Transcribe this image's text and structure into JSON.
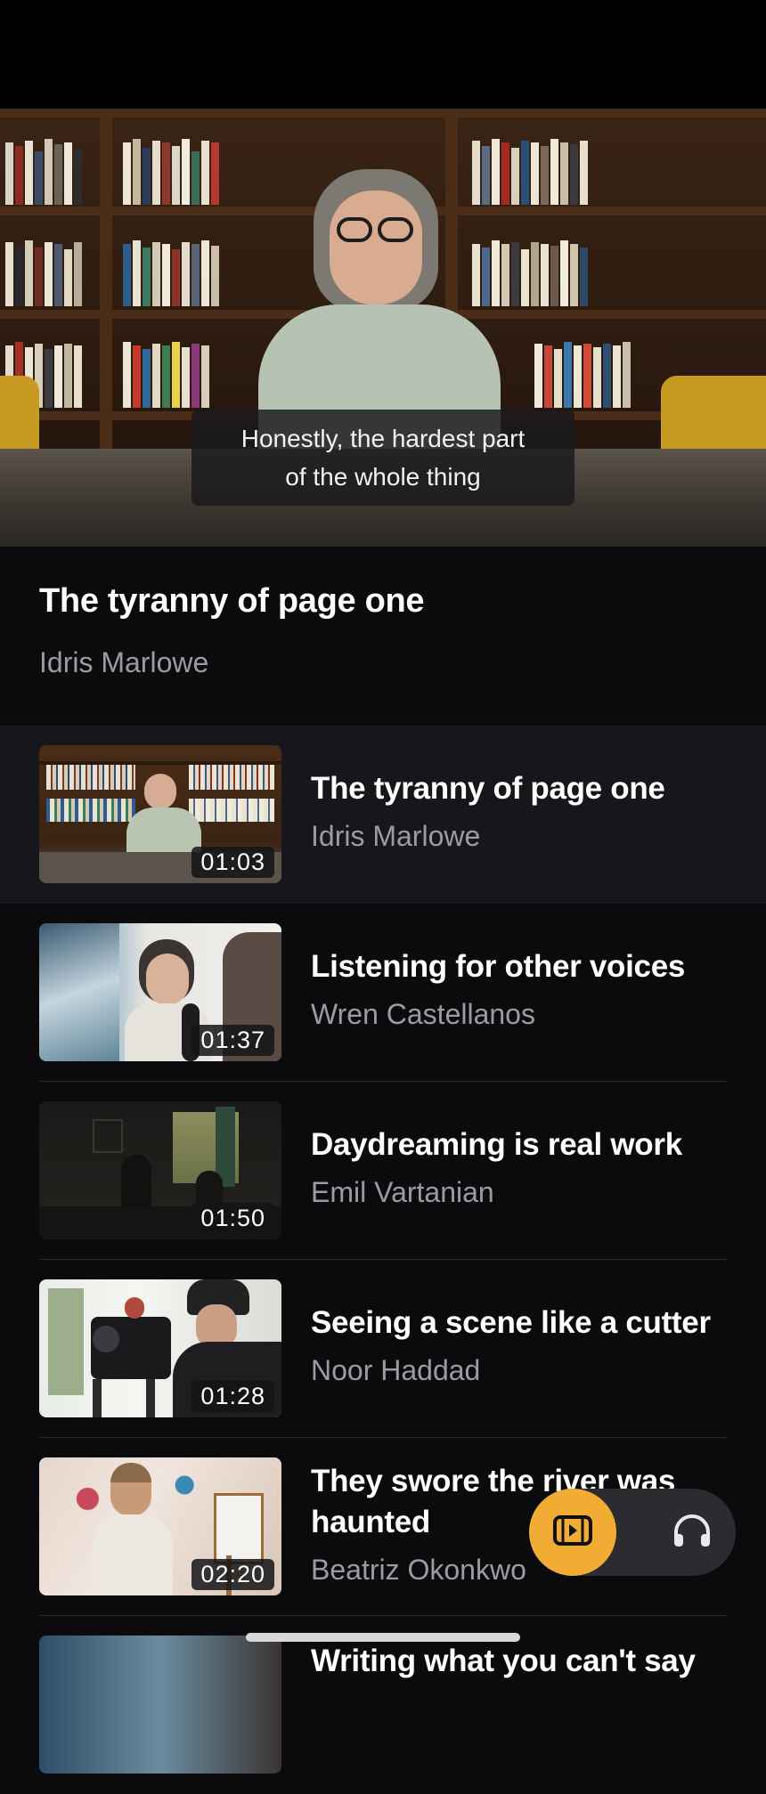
{
  "player": {
    "caption_line1": "Honestly, the hardest part",
    "caption_line2": "of the whole thing"
  },
  "now_playing": {
    "title": "The tyranny of page one",
    "author": "Idris Marlowe"
  },
  "playlist": [
    {
      "title": "The tyranny of page one",
      "author": "Idris Marlowe",
      "duration": "01:03",
      "active": true
    },
    {
      "title": "Listening for other voices",
      "author": "Wren Castellanos",
      "duration": "01:37",
      "active": false
    },
    {
      "title": "Daydreaming is real work",
      "author": "Emil Vartanian",
      "duration": "01:50",
      "active": false
    },
    {
      "title": "Seeing a scene like a cutter",
      "author": "Noor Haddad",
      "duration": "01:28",
      "active": false
    },
    {
      "title": "They swore the river was haunted",
      "author": "Beatriz Okonkwo",
      "duration": "02:20",
      "active": false
    },
    {
      "title": "Writing what you can't say",
      "author": "",
      "duration": "",
      "active": false
    }
  ],
  "mode_switch": {
    "video_icon": "video-icon",
    "audio_icon": "headphones-icon",
    "accent": "#f1ad33"
  }
}
